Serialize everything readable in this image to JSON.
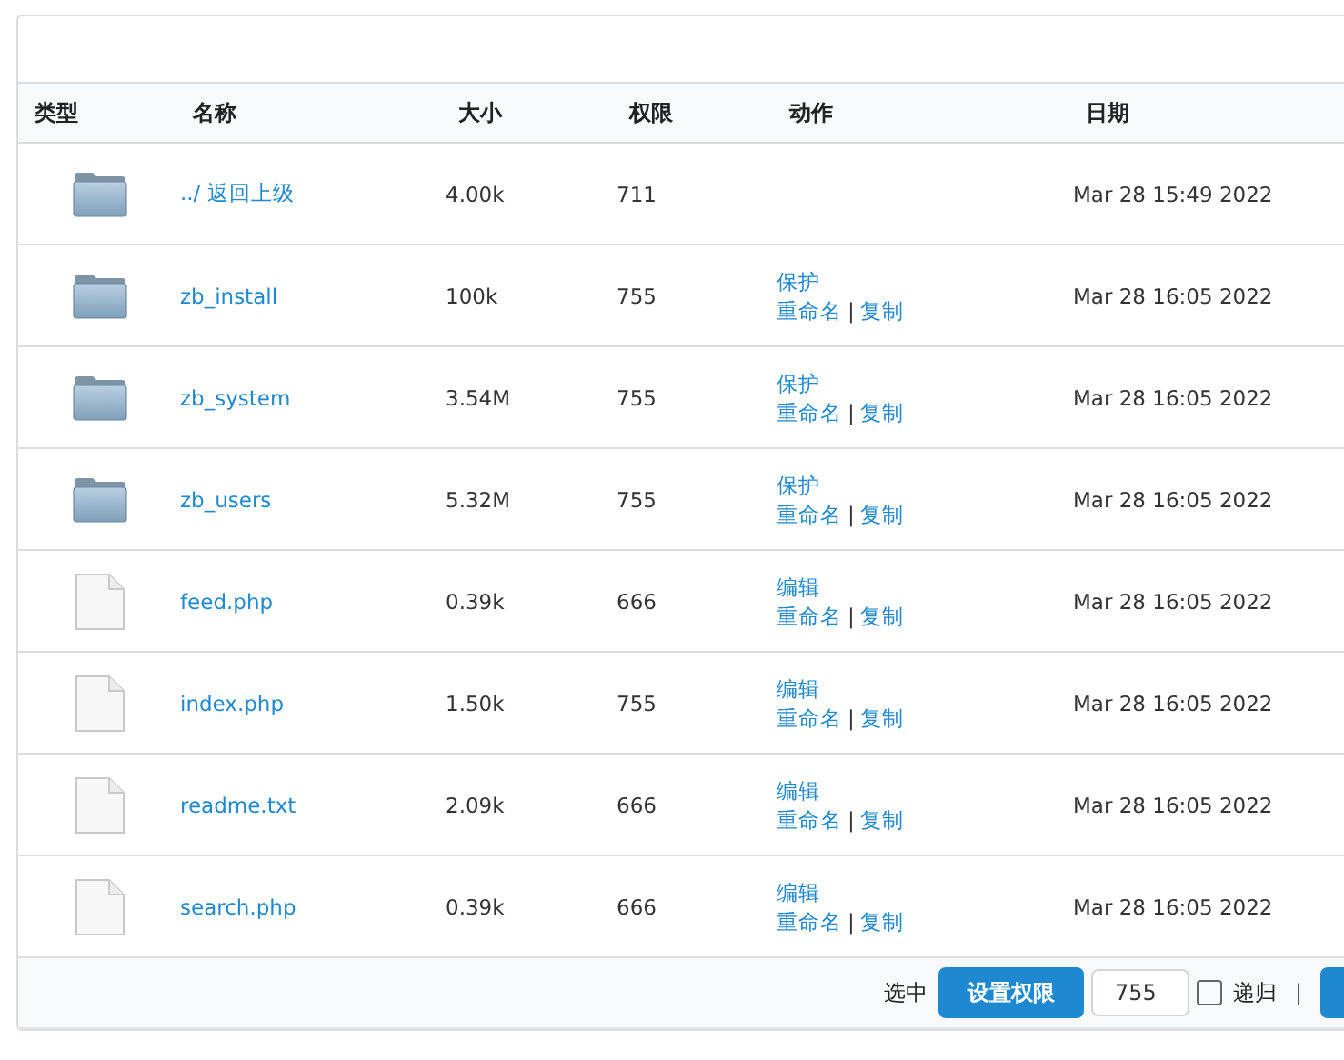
{
  "table": {
    "columns": [
      "类型",
      "名称",
      "大小",
      "权限",
      "动作",
      "日期"
    ],
    "rows": [
      {
        "kind": "folder",
        "name": "../ 返回上级",
        "size": "4.00k",
        "perm": "711",
        "date": "Mar 28 15:49 2022"
      },
      {
        "kind": "folder",
        "name": "zb_install",
        "size": "100k",
        "perm": "755",
        "actions": {
          "line1": "保护",
          "line2": [
            {
              "text": "重命名",
              "kind": "link"
            },
            {
              "text": "|",
              "kind": "sep"
            },
            {
              "text": "复制",
              "kind": "link"
            }
          ]
        },
        "date": "Mar 28 16:05 2022"
      },
      {
        "kind": "folder",
        "name": "zb_system",
        "size": "3.54M",
        "perm": "755",
        "actions": {
          "line1": "保护",
          "line2": [
            {
              "text": "重命名",
              "kind": "link"
            },
            {
              "text": "|",
              "kind": "sep"
            },
            {
              "text": "复制",
              "kind": "link"
            }
          ]
        },
        "date": "Mar 28 16:05 2022"
      },
      {
        "kind": "folder",
        "name": "zb_users",
        "size": "5.32M",
        "perm": "755",
        "actions": {
          "line1": "保护",
          "line2": [
            {
              "text": "重命名",
              "kind": "link"
            },
            {
              "text": "|",
              "kind": "sep"
            },
            {
              "text": "复制",
              "kind": "link"
            }
          ]
        },
        "date": "Mar 28 16:05 2022"
      },
      {
        "kind": "file",
        "name": "feed.php",
        "size": "0.39k",
        "perm": "666",
        "actions": {
          "line1": "编辑",
          "line2": [
            {
              "text": "重命名",
              "kind": "link"
            },
            {
              "text": "|",
              "kind": "sep"
            },
            {
              "text": "复制",
              "kind": "link"
            }
          ]
        },
        "date": "Mar 28 16:05 2022"
      },
      {
        "kind": "file",
        "name": "index.php",
        "size": "1.50k",
        "perm": "755",
        "actions": {
          "line1": "编辑",
          "line2": [
            {
              "text": "重命名",
              "kind": "link"
            },
            {
              "text": "|",
              "kind": "sep"
            },
            {
              "text": "复制",
              "kind": "link"
            }
          ]
        },
        "date": "Mar 28 16:05 2022"
      },
      {
        "kind": "file",
        "name": "readme.txt",
        "size": "2.09k",
        "perm": "666",
        "actions": {
          "line1": "编辑",
          "line2": [
            {
              "text": "重命名",
              "kind": "link"
            },
            {
              "text": "|",
              "kind": "sep"
            },
            {
              "text": "复制",
              "kind": "link"
            }
          ]
        },
        "date": "Mar 28 16:05 2022"
      },
      {
        "kind": "file",
        "name": "search.php",
        "size": "0.39k",
        "perm": "666",
        "actions": {
          "line1": "编辑",
          "line2": [
            {
              "text": "重命名",
              "kind": "link"
            },
            {
              "text": "|",
              "kind": "sep"
            },
            {
              "text": "复制",
              "kind": "link"
            }
          ]
        },
        "date": "Mar 28 16:05 2022"
      }
    ]
  },
  "footer": {
    "label": "选中",
    "set_button": "设置权限",
    "perm_value": "755",
    "recursive": {
      "label": "递归",
      "checked": false
    },
    "separator": "|"
  }
}
